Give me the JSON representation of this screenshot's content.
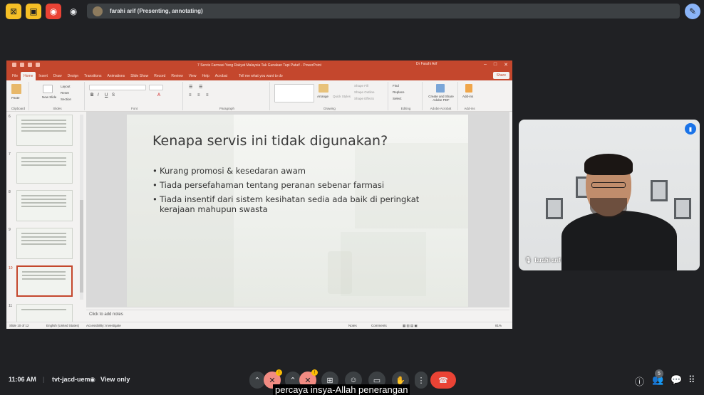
{
  "topbar": {
    "presenter_label": "farahi arif (Presenting, annotating)",
    "icons": [
      "cast-icon",
      "presentation-icon",
      "record-icon",
      "eye-icon",
      "pen-icon"
    ]
  },
  "ppt": {
    "doc_title": "7 Servis Farmasi Yang Rakyat Malaysia Tak Gunakan Tapi Patut! - PowerPoint",
    "user": "Dr Farahi Arif",
    "tabs": [
      "File",
      "Home",
      "Insert",
      "Draw",
      "Design",
      "Transitions",
      "Animations",
      "Slide Show",
      "Record",
      "Review",
      "View",
      "Help",
      "Acrobat"
    ],
    "tell_me": "Tell me what you want to do",
    "share": "Share",
    "ribbon": {
      "paste": "Paste",
      "new_slide": "New Slide",
      "layout": "Layout",
      "reset": "Reset",
      "section": "Section",
      "find": "Find",
      "replace": "Replace",
      "select": "Select",
      "arrange": "Arrange",
      "quick_styles": "Quick Styles",
      "shape_fill": "Shape Fill",
      "shape_outline": "Shape Outline",
      "shape_effects": "Shape Effects",
      "create_pdf": "Create and Share Adobe PDF",
      "addins": "Add-ins",
      "groups": [
        "Clipboard",
        "Slides",
        "Font",
        "Paragraph",
        "Drawing",
        "Editing",
        "Adobe Acrobat",
        "Add-ins"
      ]
    },
    "thumbnails": [
      {
        "num": "6"
      },
      {
        "num": "7"
      },
      {
        "num": "8"
      },
      {
        "num": "9"
      },
      {
        "num": "10"
      },
      {
        "num": "11"
      }
    ],
    "slide": {
      "title": "Kenapa servis ini tidak digunakan?",
      "bullets": [
        "Kurang promosi & kesedaran awam",
        "Tiada persefahaman tentang peranan sebenar farmasi",
        "Tiada insentif dari sistem kesihatan sedia ada baik di peringkat kerajaan mahupun swasta"
      ]
    },
    "notes_placeholder": "Click to add notes",
    "status": {
      "slide_of": "Slide 10 of 12",
      "language": "English (United States)",
      "accessibility": "Accessibility: Investigate",
      "notes": "Notes",
      "comments": "Comments",
      "zoom": "81%"
    }
  },
  "video": {
    "name": "farahi arif"
  },
  "bottom": {
    "time": "11:06 AM",
    "meeting_code": "tvt-jacd-uem",
    "view_only": "View only",
    "caption": "percaya insya-Allah penerangan",
    "participants_count": "5"
  },
  "colors": {
    "ppt_accent": "#c4472d",
    "meet_bg": "#202124",
    "end_call": "#ea4335",
    "raise_hand_warn": "#fbbc04"
  }
}
